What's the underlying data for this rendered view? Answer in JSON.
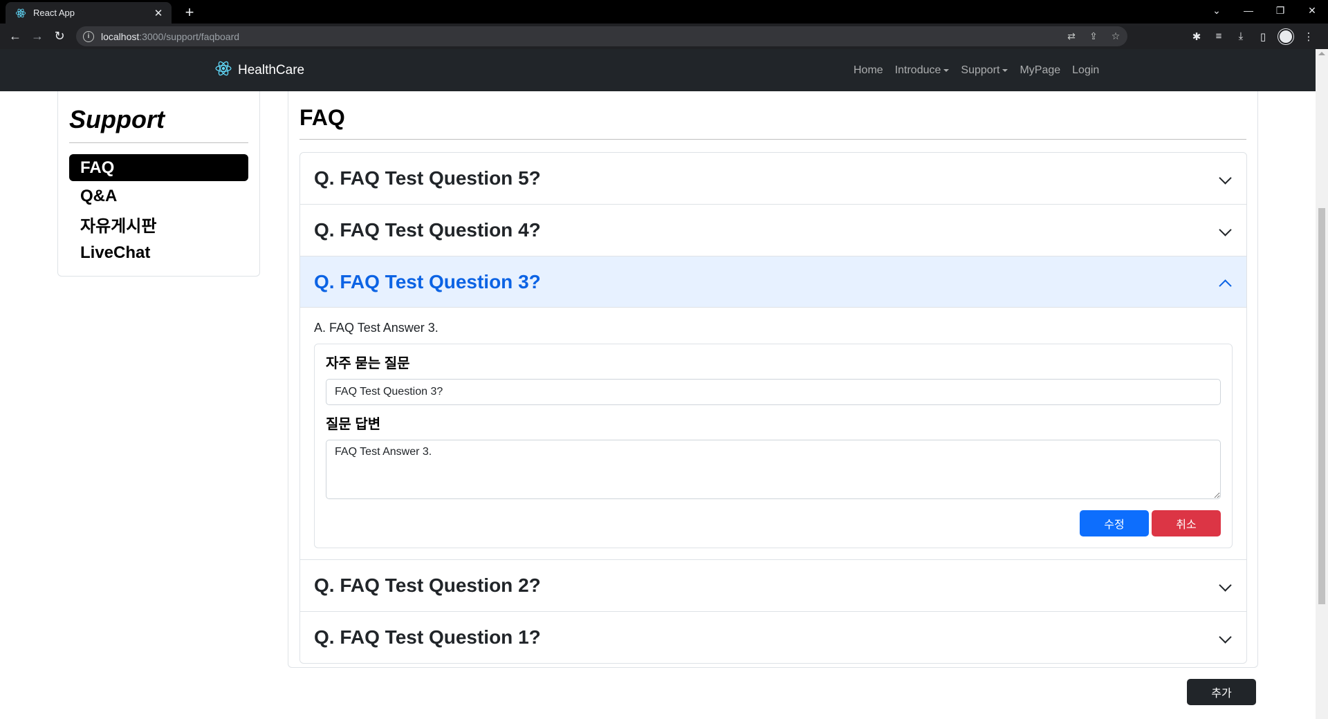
{
  "browser": {
    "tab_title": "React App",
    "url_host": "localhost",
    "url_path": ":3000/support/faqboard"
  },
  "navbar": {
    "brand": "HealthCare",
    "links": [
      "Home",
      "Introduce",
      "Support",
      "MyPage",
      "Login"
    ]
  },
  "sidebar": {
    "title": "Support",
    "items": [
      "FAQ",
      "Q&A",
      "자유게시판",
      "LiveChat"
    ],
    "active_index": 0
  },
  "main": {
    "title": "FAQ",
    "faqs": [
      {
        "question": "Q. FAQ Test Question 5?"
      },
      {
        "question": "Q. FAQ Test Question 4?"
      },
      {
        "question": "Q. FAQ Test Question 3?",
        "answer": "A. FAQ Test Answer 3."
      },
      {
        "question": "Q. FAQ Test Question 2?"
      },
      {
        "question": "Q. FAQ Test Question 1?"
      }
    ],
    "edit_form": {
      "question_label": "자주 묻는 질문",
      "question_value": "FAQ Test Question 3?",
      "answer_label": "질문 답변",
      "answer_value": "FAQ Test Answer 3.",
      "submit_label": "수정",
      "cancel_label": "취소"
    },
    "add_label": "추가"
  },
  "colors": {
    "active_accordion_bg": "#e7f1ff",
    "active_accordion_text": "#0c63e4",
    "primary": "#0d6efd",
    "danger": "#dc3545",
    "navbar_bg": "#212529"
  }
}
